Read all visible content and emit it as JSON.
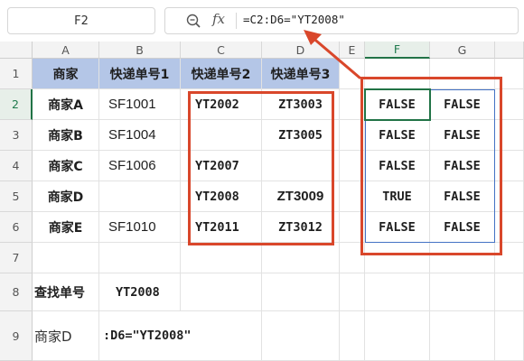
{
  "name_box": "F2",
  "formula": "=C2:D6=\"YT2008\"",
  "columns": [
    "A",
    "B",
    "C",
    "D",
    "E",
    "F",
    "G"
  ],
  "rows": [
    "1",
    "2",
    "3",
    "4",
    "5",
    "6",
    "7",
    "8",
    "9"
  ],
  "cells": {
    "A1": "商家",
    "B1": "快递单号1",
    "C1": "快递单号2",
    "D1": "快递单号3",
    "A2": "商家A",
    "B2": "SF1001",
    "C2": "YT2002",
    "D2": "ZT3003",
    "F2": "FALSE",
    "G2": "FALSE",
    "A3": "商家B",
    "B3": "SF1004",
    "C3": "",
    "D3": "ZT3005",
    "F3": "FALSE",
    "G3": "FALSE",
    "A4": "商家C",
    "B4": "SF1006",
    "C4": "YT2007",
    "D4": "",
    "F4": "FALSE",
    "G4": "FALSE",
    "A5": "商家D",
    "B5": "",
    "C5": "YT2008",
    "D5": "ZT3009",
    "F5": "TRUE",
    "G5": "FALSE",
    "A6": "商家E",
    "B6": "SF1010",
    "C6": "YT2011",
    "D6": "ZT3012",
    "F6": "FALSE",
    "G6": "FALSE",
    "A8": "查找单号",
    "B8": "YT2008",
    "A9": "商家D",
    "B9": ":D6=\"YT2008\""
  },
  "colors": {
    "header_fill": "#b4c6e7",
    "annotation_red": "#d9472b",
    "selection_green": "#217346",
    "spill_blue": "#4472c4"
  },
  "icons": [
    "zoom-icon",
    "fx-icon",
    "arrow-icon"
  ]
}
